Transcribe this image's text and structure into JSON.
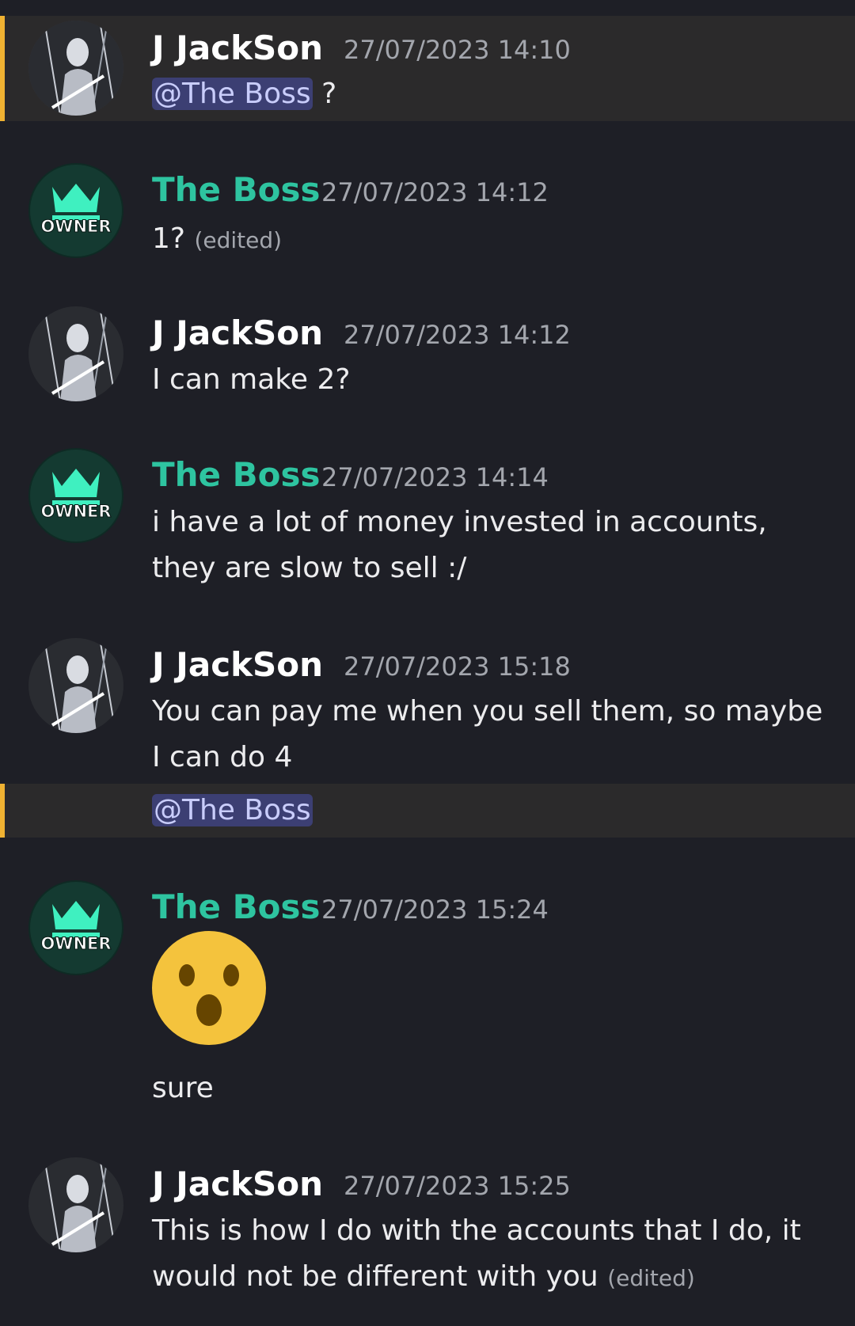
{
  "messages": [
    {
      "author": "J JackSon",
      "timestamp": "27/07/2023 14:10",
      "mention": "@The Boss",
      "text": " ?"
    },
    {
      "author": "The Boss",
      "timestamp": "27/07/2023 14:12",
      "text": "1?",
      "edited": "(edited)",
      "badge": "OWNER"
    },
    {
      "author": "J JackSon",
      "timestamp": "27/07/2023 14:12",
      "text": "I can make 2?"
    },
    {
      "author": "The Boss",
      "timestamp": "27/07/2023 14:14",
      "text": "i have a lot of money invested in accounts, they are slow to sell :/",
      "badge": "OWNER"
    },
    {
      "author": "J JackSon",
      "timestamp": "27/07/2023 15:18",
      "text": "You can pay me when you sell them, so maybe I can do 4",
      "followup_mention": "@The Boss"
    },
    {
      "author": "The Boss",
      "timestamp": "27/07/2023 15:24",
      "emoji": "hushed-face-emoji",
      "text": "sure",
      "badge": "OWNER"
    },
    {
      "author": "J JackSon",
      "timestamp": "27/07/2023 15:25",
      "text": "This is how I do with the accounts that I do, it would not be different with you",
      "edited": "(edited)"
    }
  ],
  "colors": {
    "background": "#1e1f26",
    "highlight": "#2b2a2b",
    "highlight_bar": "#f0b232",
    "boss_name": "#2ec4a0",
    "jack_name": "#ffffff",
    "mention_bg": "#3c3f73",
    "mention_text": "#c9cdfb",
    "timestamp": "#a3a6ad"
  }
}
